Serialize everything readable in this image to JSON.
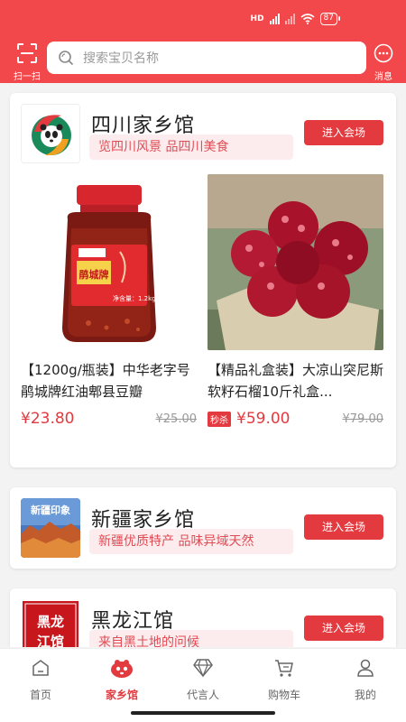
{
  "status": {
    "hd": "HD",
    "battery": "87"
  },
  "header": {
    "scan_label": "扫一扫",
    "search_placeholder": "搜索宝贝名称",
    "message_label": "消息"
  },
  "colors": {
    "brand": "#f2484b",
    "accent": "#e23a3f",
    "tag_bg": "#fdecee"
  },
  "halls": [
    {
      "name": "四川家乡馆",
      "tagline": "览四川风景  品四川美食",
      "enter_label": "进入会场",
      "logo_icon": "sichuan-panda-logo",
      "products": [
        {
          "title": "【1200g/瓶装】中华老字号 鹃城牌红油郫县豆瓣",
          "price": "¥23.80",
          "old_price": "¥25.00",
          "badge": "",
          "image_icon": "chili-bean-paste-jar",
          "jar_brand": "鹃城牌",
          "jar_weight": "净含量：1.2kg"
        },
        {
          "title": "【精品礼盒装】大凉山突尼斯软籽石榴10斤礼盒...",
          "price": "¥59.00",
          "old_price": "¥79.00",
          "badge": "秒杀",
          "image_icon": "pomegranate-photo"
        }
      ]
    },
    {
      "name": "新疆家乡馆",
      "tagline": "新疆优质特产  品味异域天然",
      "enter_label": "进入会场",
      "logo_icon": "xinjiang-landscape-logo",
      "logo_text": "新疆印象"
    },
    {
      "name": "黑龙江馆",
      "tagline": "来自黑土地的问候",
      "enter_label": "进入会场",
      "logo_icon": "heilongjiang-seal-logo",
      "logo_text": "黑龙江馆"
    }
  ],
  "tabbar": {
    "items": [
      {
        "label": "首页",
        "icon": "home-icon"
      },
      {
        "label": "家乡馆",
        "icon": "hometown-icon"
      },
      {
        "label": "代言人",
        "icon": "diamond-icon"
      },
      {
        "label": "购物车",
        "icon": "cart-icon"
      },
      {
        "label": "我的",
        "icon": "user-icon"
      }
    ],
    "active_index": 1
  }
}
